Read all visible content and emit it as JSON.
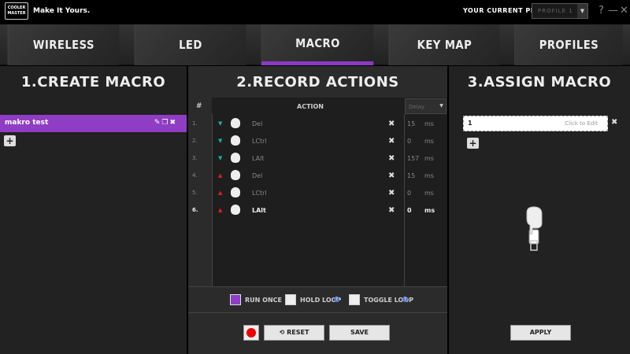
{
  "header": {
    "logo_text": "COOLER MASTER",
    "tagline": "Make It Yours.",
    "profile_label": "YOUR CURRENT PROFILE",
    "profile_value": "PROFILE 1",
    "help": "?",
    "minimize": "—",
    "close": "✕"
  },
  "tabs": [
    {
      "label": "WIRELESS"
    },
    {
      "label": "LED"
    },
    {
      "label": "MACRO"
    },
    {
      "label": "KEY MAP"
    },
    {
      "label": "PROFILES"
    }
  ],
  "create": {
    "title": "1.CREATE MACRO",
    "macros": [
      {
        "name": "makro test"
      }
    ],
    "add": "+"
  },
  "record": {
    "title": "2.RECORD ACTIONS",
    "col_num": "#",
    "col_action": "ACTION",
    "col_delay": "Delay",
    "rows": [
      {
        "num": "1.",
        "dir": "down",
        "key": "Del",
        "delay": "15",
        "unit": "ms"
      },
      {
        "num": "2.",
        "dir": "down",
        "key": "LCtrl",
        "delay": "0",
        "unit": "ms"
      },
      {
        "num": "3.",
        "dir": "down",
        "key": "LAlt",
        "delay": "157",
        "unit": "ms"
      },
      {
        "num": "4.",
        "dir": "up",
        "key": "Del",
        "delay": "15",
        "unit": "ms"
      },
      {
        "num": "5.",
        "dir": "up",
        "key": "LCtrl",
        "delay": "0",
        "unit": "ms"
      },
      {
        "num": "6.",
        "dir": "up",
        "key": "LAlt",
        "delay": "0",
        "unit": "ms"
      }
    ],
    "loop": {
      "run_once": "RUN ONCE",
      "hold_loop": "HOLD LOOP",
      "toggle_loop": "TOGGLE LOOP"
    },
    "reset": "RESET",
    "save": "SAVE"
  },
  "assign": {
    "title": "3.ASSIGN MACRO",
    "value": "1",
    "placeholder": "Click to Edit",
    "add": "+",
    "apply": "APPLY"
  },
  "colors": {
    "accent": "#8f3dc5",
    "down": "#1fa9a9",
    "up": "#e02020"
  }
}
